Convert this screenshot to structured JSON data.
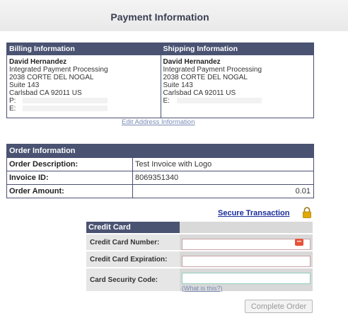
{
  "page": {
    "title": "Payment Information"
  },
  "billing": {
    "header": "Billing Information",
    "name": "David Hernandez",
    "company": "Integrated Payment Processing",
    "street": "2038 CORTE DEL NOGAL",
    "suite": "Suite 143",
    "city_line": "Carlsbad CA 92011 US",
    "phone_label": "P:",
    "email_label": "E:"
  },
  "shipping": {
    "header": "Shipping Information",
    "name": "David Hernandez",
    "company": "Integrated Payment Processing",
    "street": "2038 CORTE DEL NOGAL",
    "suite": "Suite 143",
    "city_line": "Carlsbad CA 92011 US",
    "email_label": "E:"
  },
  "edit_address_link": "Edit Address Information",
  "order": {
    "header": "Order Information",
    "rows": [
      {
        "label": "Order Description:",
        "value": "Test Invoice with Logo"
      },
      {
        "label": "Invoice ID:",
        "value": "8069351340"
      },
      {
        "label": "Order Amount:",
        "value": "0.01"
      }
    ]
  },
  "secure_link": "Secure Transaction",
  "credit_card": {
    "header": "Credit Card",
    "number_label": "Credit Card Number:",
    "number_value": "",
    "card_icon_text": "•••",
    "expiration_label": "Credit Card Expiration:",
    "expiration_value": "",
    "security_label": "Card Security Code:",
    "security_value": "",
    "what_is_this": "(What is this?)"
  },
  "complete_button": "Complete Order",
  "colors": {
    "header_bg": "#4a5372",
    "link": "#1a2d9c",
    "muted_link": "#7a8bb5",
    "lock": "#e0a800"
  },
  "icons": {
    "lock": "lock-icon",
    "card": "credit-card-icon"
  }
}
